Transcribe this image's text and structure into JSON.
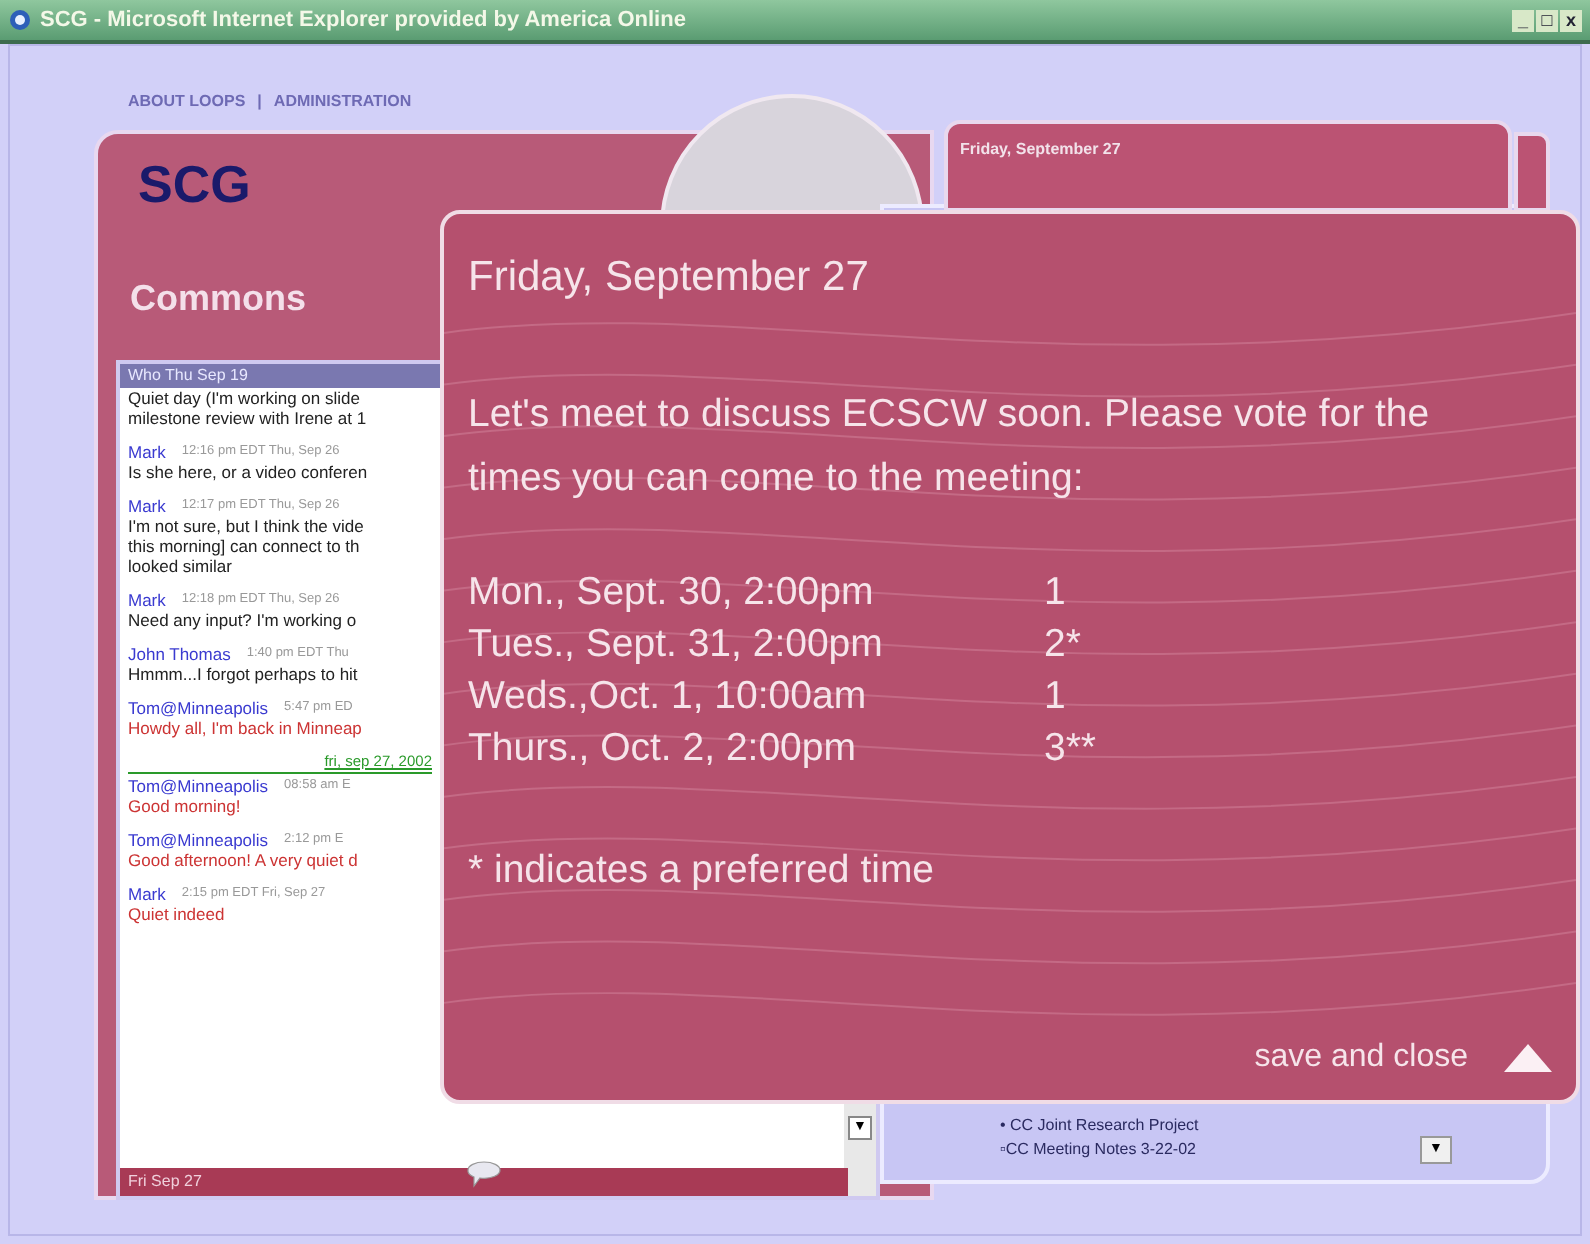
{
  "window": {
    "title": "SCG - Microsoft Internet Explorer provided by America Online",
    "controls": [
      "_",
      "□",
      "x"
    ]
  },
  "nav": [
    "ABOUT LOOPS",
    "|",
    "ADMINISTRATION"
  ],
  "site": {
    "logo": "SCG",
    "section": "Commons"
  },
  "chat": {
    "header": "Who Thu Sep 19",
    "footer": "Fri Sep 27",
    "messages": [
      {
        "lines": [
          "Quiet day (I'm working on slide",
          "milestone review with Irene at 1"
        ],
        "color": "#222222"
      },
      {
        "author": "Mark",
        "time": "12:16 pm EDT Thu, Sep 26",
        "lines": [
          "Is she here, or a video conferen"
        ],
        "color": "#222222"
      },
      {
        "author": "Mark",
        "time": "12:17 pm EDT Thu, Sep 26",
        "lines": [
          "I'm not sure, but I think the vide",
          "this morning] can connect to th",
          "looked similar"
        ],
        "color": "#222222"
      },
      {
        "author": "Mark",
        "time": "12:18 pm EDT Thu, Sep 26",
        "lines": [
          "Need any input?  I'm working o"
        ],
        "color": "#222222"
      },
      {
        "author": "John Thomas",
        "time": "1:40 pm EDT Thu",
        "lines": [
          "Hmmm...I forgot perhaps to hit"
        ],
        "color": "#222222"
      },
      {
        "author": "Tom@Minneapolis",
        "time": "5:47 pm ED",
        "lines": [
          "Howdy all, I'm back in Minneap"
        ],
        "color": "#cc3333"
      },
      {
        "kind": "divider",
        "text": "fri, sep 27, 2002"
      },
      {
        "author": "Tom@Minneapolis",
        "time": "08:58 am E",
        "lines": [
          "Good morning!"
        ],
        "color": "#cc3333"
      },
      {
        "author": "Tom@Minneapolis",
        "time": "2:12 pm E",
        "lines": [
          "Good afternoon! A very quiet d"
        ],
        "color": "#cc3333"
      },
      {
        "author": "Mark",
        "time": "2:15 pm EDT Fri, Sep 27",
        "lines": [
          "Quiet indeed"
        ],
        "color": "#cc3333"
      }
    ]
  },
  "chat_scroll_arrow": "▼",
  "calendar_tab": {
    "title": "Friday, September 27"
  },
  "documents_dropdown": "▼",
  "documents": [
    {
      "label": "• CC Joint Research Project"
    },
    {
      "label": "▫CC Meeting Notes 3-22-02"
    }
  ],
  "popup": {
    "title": "Friday, September 27",
    "message": "Let's meet to discuss ECSCW soon.  Please vote for the times you can come to the meeting:",
    "options": [
      {
        "time": "Mon., Sept. 30, 2:00pm",
        "votes": "1"
      },
      {
        "time": "Tues., Sept. 31, 2:00pm",
        "votes": "2*"
      },
      {
        "time": "Weds.,Oct. 1, 10:00am",
        "votes": "1"
      },
      {
        "time": "Thurs., Oct. 2, 2:00pm",
        "votes": "3**"
      }
    ],
    "note": "* indicates a preferred time",
    "save_label": "save and close"
  }
}
